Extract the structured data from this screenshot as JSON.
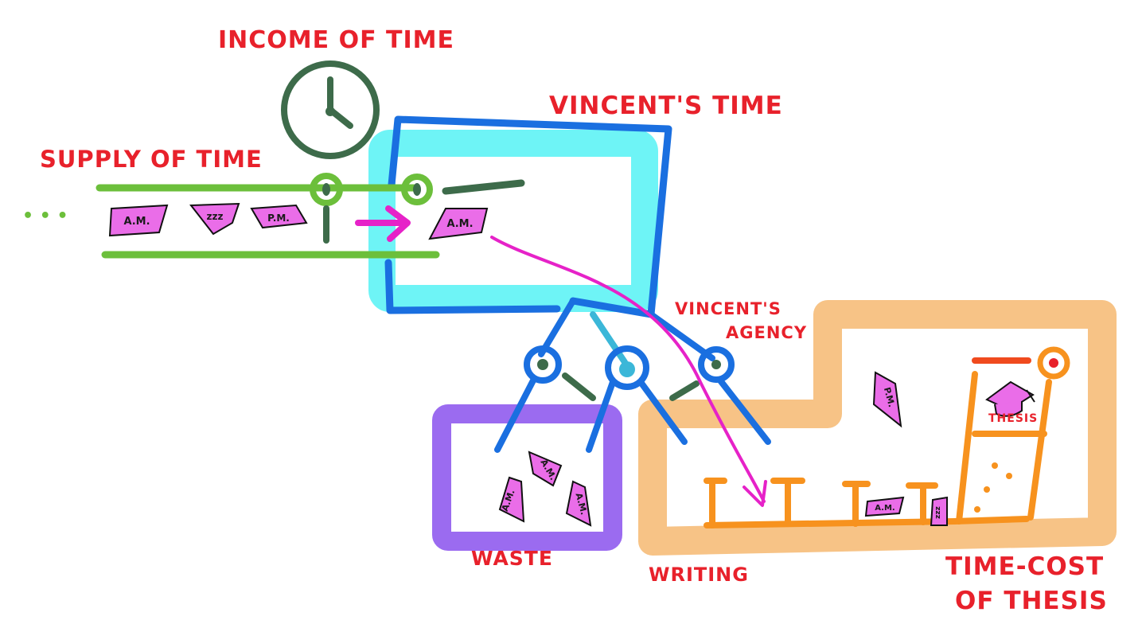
{
  "labels": {
    "income": "INCOME OF TIME",
    "supply": "SUPPLY OF TIME",
    "vincents_time": "VINCENT'S TIME",
    "agency_line1": "VINCENT'S",
    "agency_line2": "AGENCY",
    "waste": "WASTE",
    "writing": "WRITING",
    "timecost_line1": "TIME-COST",
    "timecost_line2": "OF THESIS",
    "thesis": "THESIS"
  },
  "chips": {
    "am": "A.M.",
    "pm": "P.M.",
    "zzz": "zzz"
  },
  "ellipsis": "• • •",
  "colors": {
    "label_red": "#e8212b",
    "supply_green": "#6cbf3b",
    "valve_dark_green": "#3d6b4a",
    "stock_blue": "#1a6fe0",
    "stock_cyan": "#5ef3f5",
    "waste_purple": "#9b6bf0",
    "writing_orange": "#f6b871",
    "thesis_orange": "#f7921e",
    "flow_magenta": "#e622c8",
    "time_chip_pink": "#ea6de8"
  }
}
